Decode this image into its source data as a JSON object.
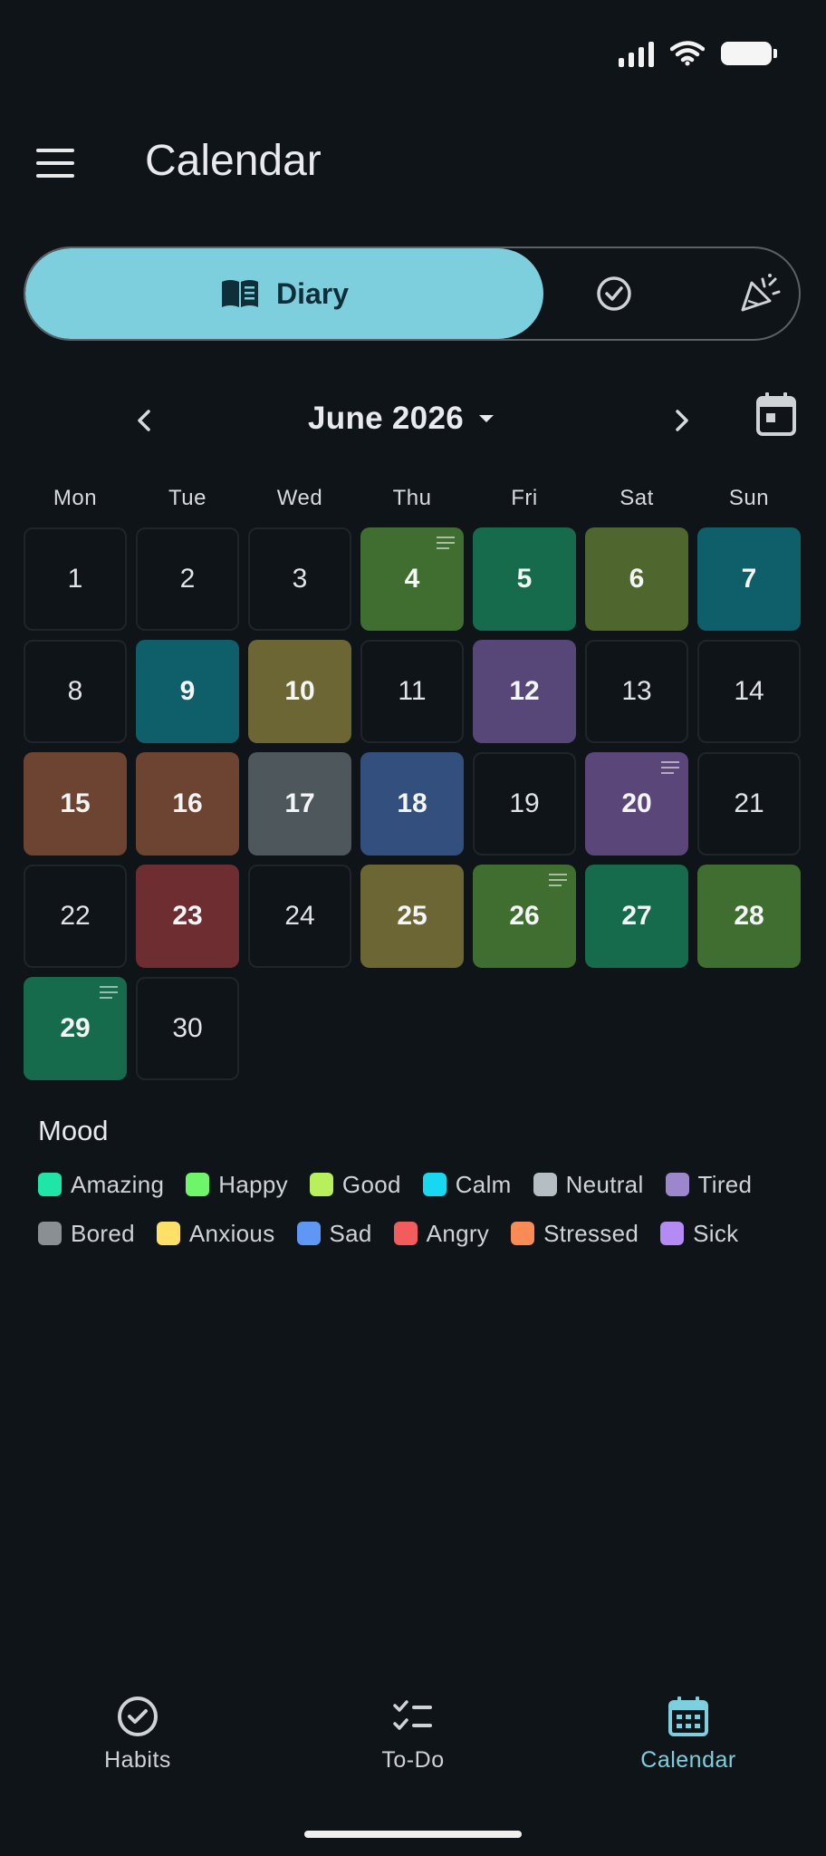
{
  "header": {
    "title": "Calendar"
  },
  "tabs": {
    "diary_label": "Diary"
  },
  "month_nav": {
    "month_label": "June 2026"
  },
  "weekdays": [
    "Mon",
    "Tue",
    "Wed",
    "Thu",
    "Fri",
    "Sat",
    "Sun"
  ],
  "days": [
    {
      "n": "1",
      "color": null,
      "note": false
    },
    {
      "n": "2",
      "color": null,
      "note": false
    },
    {
      "n": "3",
      "color": null,
      "note": false
    },
    {
      "n": "4",
      "color": "#3f6e30",
      "note": true
    },
    {
      "n": "5",
      "color": "#176b4d",
      "note": false
    },
    {
      "n": "6",
      "color": "#4f672f",
      "note": false
    },
    {
      "n": "7",
      "color": "#0f5f6b",
      "note": false
    },
    {
      "n": "8",
      "color": null,
      "note": false
    },
    {
      "n": "9",
      "color": "#0f5f6b",
      "note": false
    },
    {
      "n": "10",
      "color": "#6b6633",
      "note": false
    },
    {
      "n": "11",
      "color": null,
      "note": false
    },
    {
      "n": "12",
      "color": "#574779",
      "note": false
    },
    {
      "n": "13",
      "color": null,
      "note": false
    },
    {
      "n": "14",
      "color": null,
      "note": false
    },
    {
      "n": "15",
      "color": "#6d4431",
      "note": false
    },
    {
      "n": "16",
      "color": "#6d4431",
      "note": false
    },
    {
      "n": "17",
      "color": "#4e575b",
      "note": false
    },
    {
      "n": "18",
      "color": "#334f7d",
      "note": false
    },
    {
      "n": "19",
      "color": null,
      "note": false
    },
    {
      "n": "20",
      "color": "#5a4679",
      "note": true
    },
    {
      "n": "21",
      "color": null,
      "note": false
    },
    {
      "n": "22",
      "color": null,
      "note": false
    },
    {
      "n": "23",
      "color": "#6e2d31",
      "note": false
    },
    {
      "n": "24",
      "color": null,
      "note": false
    },
    {
      "n": "25",
      "color": "#6b6633",
      "note": false
    },
    {
      "n": "26",
      "color": "#3f6e30",
      "note": true
    },
    {
      "n": "27",
      "color": "#176b4d",
      "note": false
    },
    {
      "n": "28",
      "color": "#3f6e30",
      "note": false
    },
    {
      "n": "29",
      "color": "#176b4d",
      "note": true
    },
    {
      "n": "30",
      "color": null,
      "note": false
    }
  ],
  "legend": {
    "title": "Mood",
    "items": [
      {
        "label": "Amazing",
        "color": "#1fe6a6"
      },
      {
        "label": "Happy",
        "color": "#6ff56a"
      },
      {
        "label": "Good",
        "color": "#b7f05a"
      },
      {
        "label": "Calm",
        "color": "#17d8f0"
      },
      {
        "label": "Neutral",
        "color": "#b4bec3"
      },
      {
        "label": "Tired",
        "color": "#9c86cc"
      },
      {
        "label": "Bored",
        "color": "#8a8f94"
      },
      {
        "label": "Anxious",
        "color": "#fde068"
      },
      {
        "label": "Sad",
        "color": "#5f97f4"
      },
      {
        "label": "Angry",
        "color": "#f25c5c"
      },
      {
        "label": "Stressed",
        "color": "#f98b55"
      },
      {
        "label": "Sick",
        "color": "#b48af5"
      }
    ]
  },
  "bottom_nav": {
    "habits": "Habits",
    "todo": "To-Do",
    "calendar": "Calendar",
    "active_color": "#7ecfdd"
  }
}
